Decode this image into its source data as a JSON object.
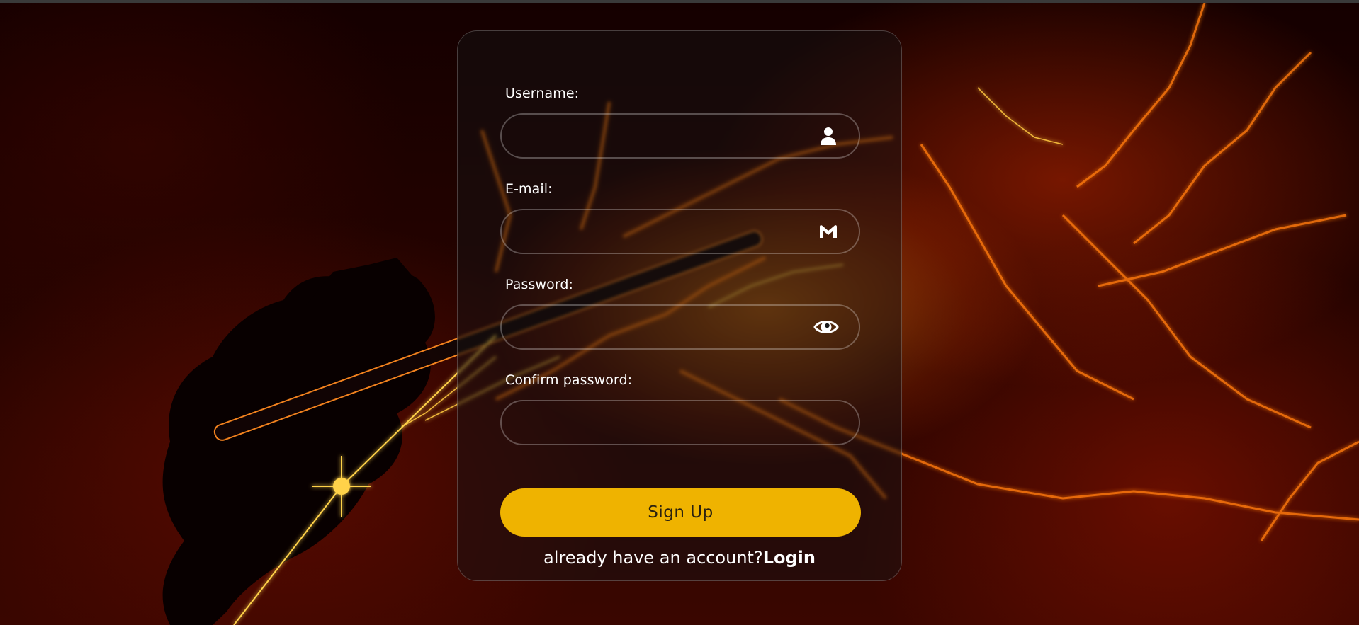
{
  "form": {
    "username": {
      "label": "Username:",
      "value": "",
      "icon": "user-icon"
    },
    "email": {
      "label": "E-mail:",
      "value": "",
      "icon": "mail-icon"
    },
    "password": {
      "label": "Password:",
      "value": "",
      "icon": "eye-icon"
    },
    "confirm_password": {
      "label": "Confirm password:",
      "value": ""
    },
    "signup_label": "Sign Up",
    "footer_text": "already have an account?",
    "login_label": "Login"
  },
  "colors": {
    "accent": "#efb300",
    "button_text": "#2b2210",
    "text": "#ffffff"
  }
}
